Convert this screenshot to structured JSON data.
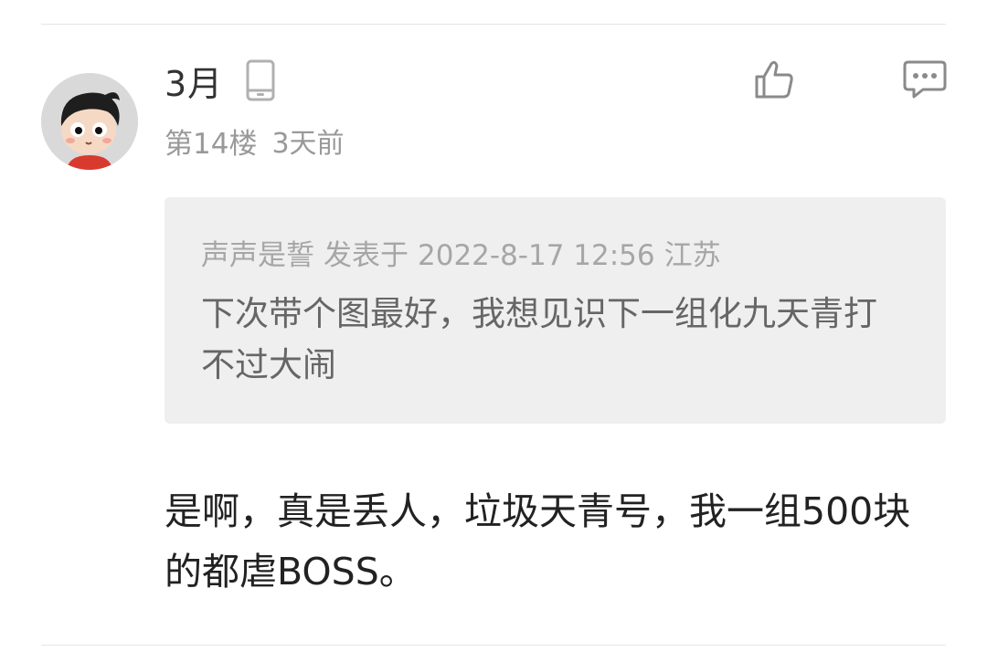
{
  "comment": {
    "username": "3月",
    "floor": "第14楼",
    "time": "3天前",
    "icons": {
      "device": "phone-icon",
      "like": "thumbs-up-icon",
      "reply": "comment-bubble-icon"
    },
    "quote": {
      "author": "声声是誓",
      "posted_label": "发表于",
      "datetime": "2022-8-17 12:56",
      "location": "江苏",
      "text": "下次带个图最好，我想见识下一组化九天青打不过大闹"
    },
    "reply": "是啊，真是丢人，垃圾天青号，我一组500块的都虐BOSS。"
  },
  "colors": {
    "background": "#ffffff",
    "quote_background": "#efefef",
    "primary_text": "#222222",
    "secondary_text": "#999999"
  }
}
